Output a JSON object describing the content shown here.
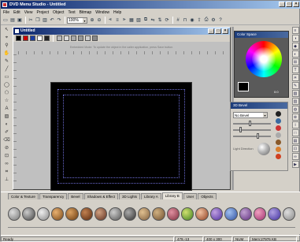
{
  "window": {
    "title": "DVD Menu Studio - Untitled"
  },
  "menu": [
    "File",
    "Edit",
    "View",
    "Project",
    "Object",
    "Text",
    "Bitmap",
    "Window",
    "Help"
  ],
  "toolbar": {
    "zoom": "100%"
  },
  "document": {
    "title": "Untitled",
    "hint": "Embedded Mode: To update the object in the caller application, press Save button."
  },
  "colorspace": {
    "title": "Color Space",
    "ratio": "0:0"
  },
  "bevel": {
    "title": "3D Bevel",
    "selected": "No Bevel",
    "light_label": "Light Direction"
  },
  "tabs": [
    "Color & Texture",
    "Transparency",
    "Bevel",
    "Shadows & Effect",
    "3D Lights",
    "Library A",
    "Library B",
    "User",
    "Objects"
  ],
  "active_tab": "Library B",
  "status": {
    "ready": "Ready",
    "coords": "479,-13",
    "size": "400 x 300",
    "num": "NUM",
    "mem": "Mem:27976 KB"
  },
  "colors": {
    "title_start": "#0a246a",
    "title_end": "#a6caf0",
    "canvas": "#000000",
    "safe_area": "#6a6ad0"
  }
}
